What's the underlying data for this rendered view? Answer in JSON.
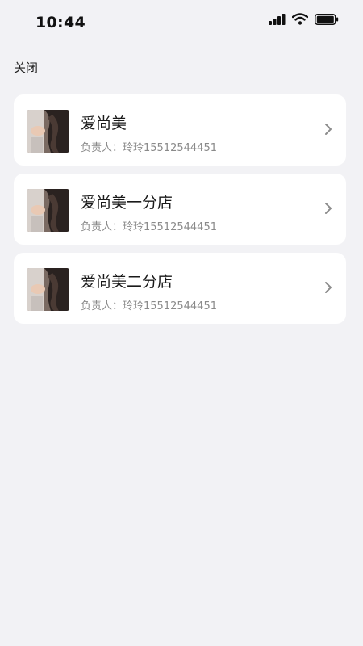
{
  "status_bar": {
    "time": "10:44",
    "icons": [
      "signal-icon",
      "wifi-icon",
      "battery-icon"
    ]
  },
  "header": {
    "close_label": "关闭"
  },
  "stores": [
    {
      "name": "爱尚美",
      "manager": "负责人：玲玲15512544451",
      "thumbnail_icon": "store-photo-icon"
    },
    {
      "name": "爱尚美一分店",
      "manager": "负责人：玲玲15512544451",
      "thumbnail_icon": "store-photo-icon"
    },
    {
      "name": "爱尚美二分店",
      "manager": "负责人：玲玲15512544451",
      "thumbnail_icon": "store-photo-icon"
    }
  ],
  "colors": {
    "background": "#f2f2f5",
    "card": "#ffffff",
    "secondary_text": "#8a8a8a",
    "chevron": "#8c8c8c"
  }
}
